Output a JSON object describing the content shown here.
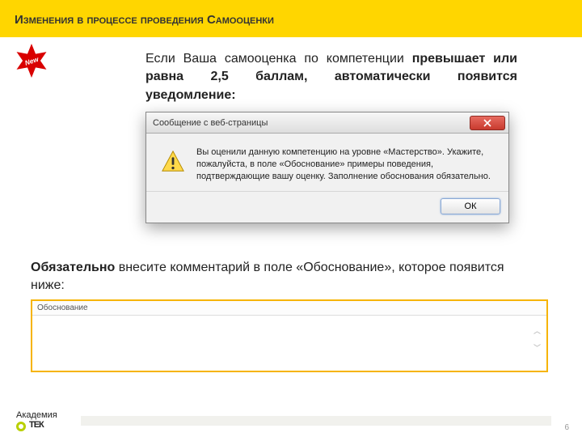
{
  "header": {
    "title": "Изменения в процессе проведения Самооценки"
  },
  "badge": {
    "label": "New"
  },
  "intro": {
    "part1": "Если Ваша самооценка по компетенции ",
    "bold": "превышает или равна 2,5 баллам, автоматически появится уведомление:",
    "part2": ""
  },
  "dialog": {
    "title": "Сообщение с веб-страницы",
    "body": "Вы оценили данную компетенцию на уровне «Мастерство». Укажите, пожалуйста, в поле «Обоснование» примеры поведения, подтверждающие вашу оценку. Заполнение обоснования обязательно.",
    "ok": "ОК"
  },
  "note2": {
    "bold": "Обязательно",
    "rest": " внесите комментарий в поле «Обоснование», которое появится ниже:"
  },
  "justification": {
    "label": "Обоснование"
  },
  "brand": {
    "line1": "Академия",
    "line2": "ТЕК"
  },
  "page": "6"
}
